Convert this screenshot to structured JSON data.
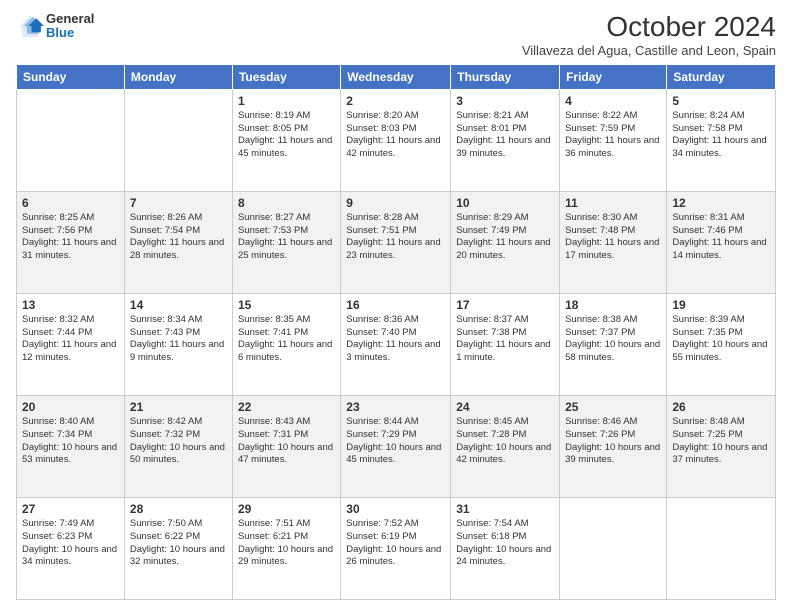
{
  "header": {
    "logo": {
      "general": "General",
      "blue": "Blue"
    },
    "title": "October 2024",
    "subtitle": "Villaveza del Agua, Castille and Leon, Spain"
  },
  "days_of_week": [
    "Sunday",
    "Monday",
    "Tuesday",
    "Wednesday",
    "Thursday",
    "Friday",
    "Saturday"
  ],
  "weeks": [
    [
      {
        "day": null
      },
      {
        "day": null
      },
      {
        "day": "1",
        "sunrise": "Sunrise: 8:19 AM",
        "sunset": "Sunset: 8:05 PM",
        "daylight": "Daylight: 11 hours and 45 minutes."
      },
      {
        "day": "2",
        "sunrise": "Sunrise: 8:20 AM",
        "sunset": "Sunset: 8:03 PM",
        "daylight": "Daylight: 11 hours and 42 minutes."
      },
      {
        "day": "3",
        "sunrise": "Sunrise: 8:21 AM",
        "sunset": "Sunset: 8:01 PM",
        "daylight": "Daylight: 11 hours and 39 minutes."
      },
      {
        "day": "4",
        "sunrise": "Sunrise: 8:22 AM",
        "sunset": "Sunset: 7:59 PM",
        "daylight": "Daylight: 11 hours and 36 minutes."
      },
      {
        "day": "5",
        "sunrise": "Sunrise: 8:24 AM",
        "sunset": "Sunset: 7:58 PM",
        "daylight": "Daylight: 11 hours and 34 minutes."
      }
    ],
    [
      {
        "day": "6",
        "sunrise": "Sunrise: 8:25 AM",
        "sunset": "Sunset: 7:56 PM",
        "daylight": "Daylight: 11 hours and 31 minutes."
      },
      {
        "day": "7",
        "sunrise": "Sunrise: 8:26 AM",
        "sunset": "Sunset: 7:54 PM",
        "daylight": "Daylight: 11 hours and 28 minutes."
      },
      {
        "day": "8",
        "sunrise": "Sunrise: 8:27 AM",
        "sunset": "Sunset: 7:53 PM",
        "daylight": "Daylight: 11 hours and 25 minutes."
      },
      {
        "day": "9",
        "sunrise": "Sunrise: 8:28 AM",
        "sunset": "Sunset: 7:51 PM",
        "daylight": "Daylight: 11 hours and 23 minutes."
      },
      {
        "day": "10",
        "sunrise": "Sunrise: 8:29 AM",
        "sunset": "Sunset: 7:49 PM",
        "daylight": "Daylight: 11 hours and 20 minutes."
      },
      {
        "day": "11",
        "sunrise": "Sunrise: 8:30 AM",
        "sunset": "Sunset: 7:48 PM",
        "daylight": "Daylight: 11 hours and 17 minutes."
      },
      {
        "day": "12",
        "sunrise": "Sunrise: 8:31 AM",
        "sunset": "Sunset: 7:46 PM",
        "daylight": "Daylight: 11 hours and 14 minutes."
      }
    ],
    [
      {
        "day": "13",
        "sunrise": "Sunrise: 8:32 AM",
        "sunset": "Sunset: 7:44 PM",
        "daylight": "Daylight: 11 hours and 12 minutes."
      },
      {
        "day": "14",
        "sunrise": "Sunrise: 8:34 AM",
        "sunset": "Sunset: 7:43 PM",
        "daylight": "Daylight: 11 hours and 9 minutes."
      },
      {
        "day": "15",
        "sunrise": "Sunrise: 8:35 AM",
        "sunset": "Sunset: 7:41 PM",
        "daylight": "Daylight: 11 hours and 6 minutes."
      },
      {
        "day": "16",
        "sunrise": "Sunrise: 8:36 AM",
        "sunset": "Sunset: 7:40 PM",
        "daylight": "Daylight: 11 hours and 3 minutes."
      },
      {
        "day": "17",
        "sunrise": "Sunrise: 8:37 AM",
        "sunset": "Sunset: 7:38 PM",
        "daylight": "Daylight: 11 hours and 1 minute."
      },
      {
        "day": "18",
        "sunrise": "Sunrise: 8:38 AM",
        "sunset": "Sunset: 7:37 PM",
        "daylight": "Daylight: 10 hours and 58 minutes."
      },
      {
        "day": "19",
        "sunrise": "Sunrise: 8:39 AM",
        "sunset": "Sunset: 7:35 PM",
        "daylight": "Daylight: 10 hours and 55 minutes."
      }
    ],
    [
      {
        "day": "20",
        "sunrise": "Sunrise: 8:40 AM",
        "sunset": "Sunset: 7:34 PM",
        "daylight": "Daylight: 10 hours and 53 minutes."
      },
      {
        "day": "21",
        "sunrise": "Sunrise: 8:42 AM",
        "sunset": "Sunset: 7:32 PM",
        "daylight": "Daylight: 10 hours and 50 minutes."
      },
      {
        "day": "22",
        "sunrise": "Sunrise: 8:43 AM",
        "sunset": "Sunset: 7:31 PM",
        "daylight": "Daylight: 10 hours and 47 minutes."
      },
      {
        "day": "23",
        "sunrise": "Sunrise: 8:44 AM",
        "sunset": "Sunset: 7:29 PM",
        "daylight": "Daylight: 10 hours and 45 minutes."
      },
      {
        "day": "24",
        "sunrise": "Sunrise: 8:45 AM",
        "sunset": "Sunset: 7:28 PM",
        "daylight": "Daylight: 10 hours and 42 minutes."
      },
      {
        "day": "25",
        "sunrise": "Sunrise: 8:46 AM",
        "sunset": "Sunset: 7:26 PM",
        "daylight": "Daylight: 10 hours and 39 minutes."
      },
      {
        "day": "26",
        "sunrise": "Sunrise: 8:48 AM",
        "sunset": "Sunset: 7:25 PM",
        "daylight": "Daylight: 10 hours and 37 minutes."
      }
    ],
    [
      {
        "day": "27",
        "sunrise": "Sunrise: 7:49 AM",
        "sunset": "Sunset: 6:23 PM",
        "daylight": "Daylight: 10 hours and 34 minutes."
      },
      {
        "day": "28",
        "sunrise": "Sunrise: 7:50 AM",
        "sunset": "Sunset: 6:22 PM",
        "daylight": "Daylight: 10 hours and 32 minutes."
      },
      {
        "day": "29",
        "sunrise": "Sunrise: 7:51 AM",
        "sunset": "Sunset: 6:21 PM",
        "daylight": "Daylight: 10 hours and 29 minutes."
      },
      {
        "day": "30",
        "sunrise": "Sunrise: 7:52 AM",
        "sunset": "Sunset: 6:19 PM",
        "daylight": "Daylight: 10 hours and 26 minutes."
      },
      {
        "day": "31",
        "sunrise": "Sunrise: 7:54 AM",
        "sunset": "Sunset: 6:18 PM",
        "daylight": "Daylight: 10 hours and 24 minutes."
      },
      {
        "day": null
      },
      {
        "day": null
      }
    ]
  ]
}
